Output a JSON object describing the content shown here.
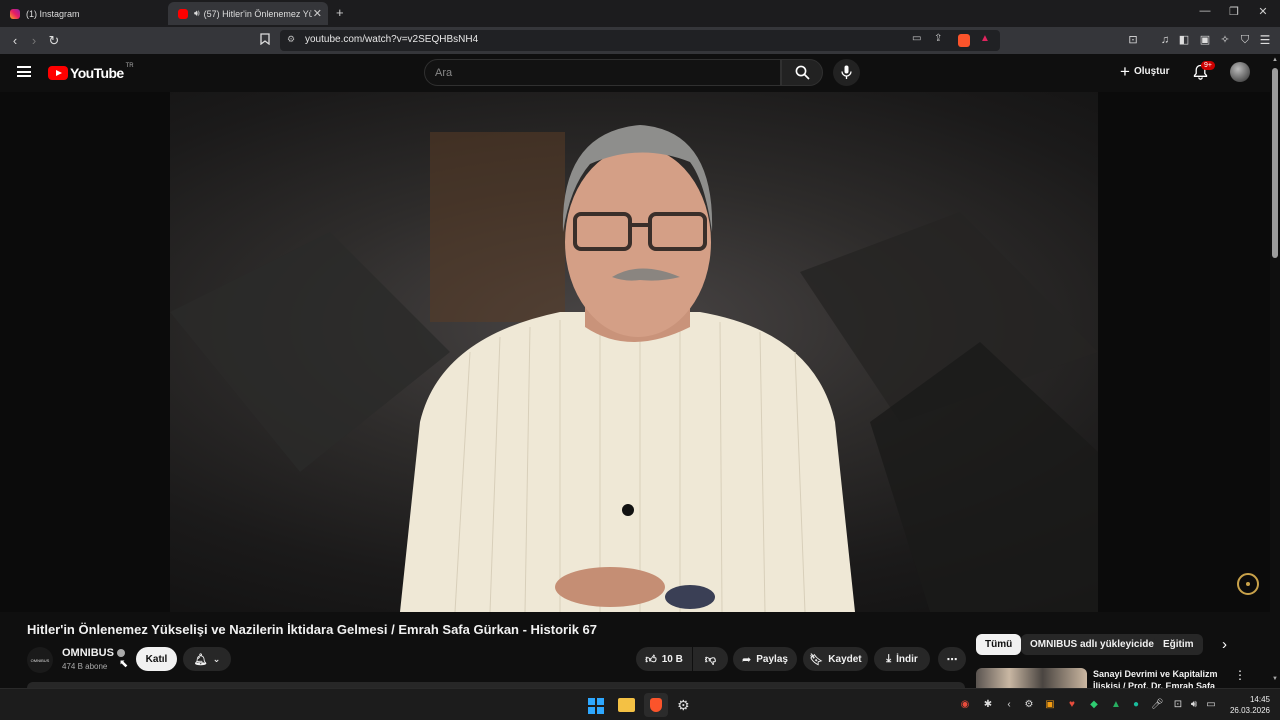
{
  "browser": {
    "tabs": [
      {
        "title": "(1) Instagram"
      },
      {
        "title": "(57) Hitler'in Önlenemez Yükse"
      }
    ],
    "new_tab": "+",
    "url": "youtube.com/watch?v=v2SEQHBsNH4"
  },
  "youtube": {
    "logo_text": "YouTube",
    "logo_region": "TR",
    "search_placeholder": "Ara",
    "create_label": "Oluştur",
    "notification_count": "9+",
    "brand_red": "#ff0000"
  },
  "video": {
    "title": "Hitler'in Önlenemez Yükselişi ve Nazilerin İktidara Gelmesi / Emrah Safa Gürkan - Historik 67"
  },
  "channel": {
    "name": "OMNIBUS",
    "avatar_text": "OMNIBUS",
    "subscribers": "474 B abone",
    "join_label": "Katıl"
  },
  "actions": {
    "likes": "10 B",
    "share": "Paylaş",
    "save": "Kaydet",
    "download": "İndir"
  },
  "chips": [
    {
      "label": "Tümü"
    },
    {
      "label": "OMNIBUS adlı yükleyiciden"
    },
    {
      "label": "Eğitim"
    }
  ],
  "recommendation": {
    "title_line1": "Sanayi Devrimi ve Kapitalizm",
    "title_line2": "İlişkisi / Prof. Dr. Emrah Safa"
  },
  "taskbar": {
    "time": "14:45",
    "date": "26.03.2026"
  }
}
